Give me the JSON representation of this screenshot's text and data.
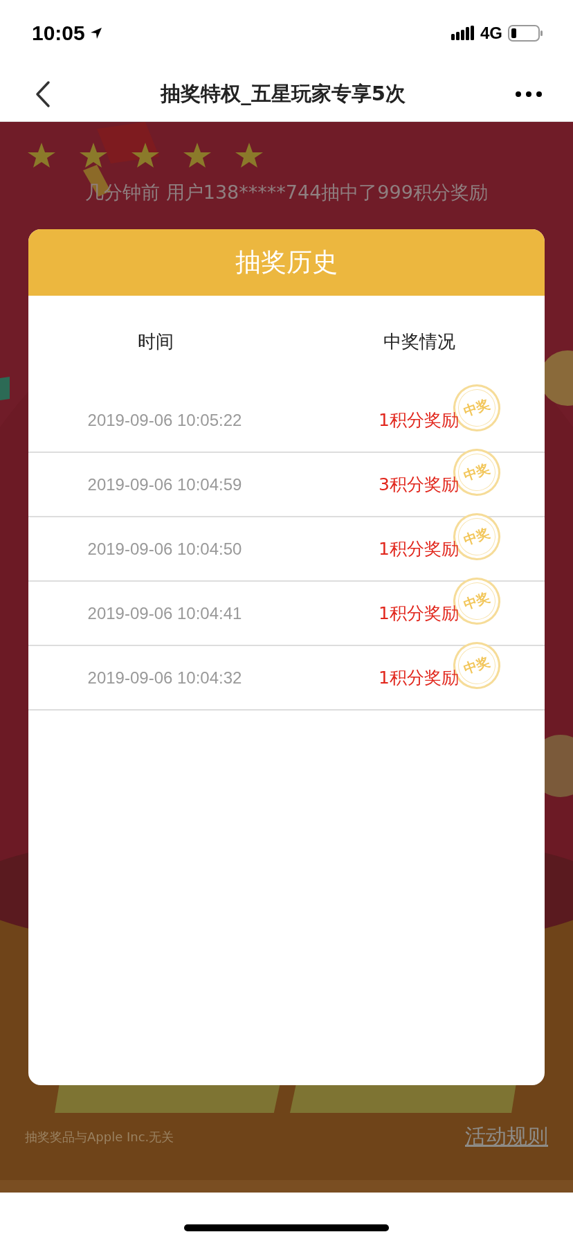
{
  "status_bar": {
    "time": "10:05",
    "network": "4G"
  },
  "nav": {
    "title": "抽奖特权_五星玩家专享5次"
  },
  "ticker": "几分钟前 用户138*****744抽中了999积分奖励",
  "modal": {
    "title": "抽奖历史",
    "columns": [
      "时间",
      "中奖情况"
    ],
    "rows": [
      {
        "time": "2019-09-06 10:05:22",
        "prize": "1积分奖励",
        "stamp": "中奖"
      },
      {
        "time": "2019-09-06 10:04:59",
        "prize": "3积分奖励",
        "stamp": "中奖"
      },
      {
        "time": "2019-09-06 10:04:50",
        "prize": "1积分奖励",
        "stamp": "中奖"
      },
      {
        "time": "2019-09-06 10:04:41",
        "prize": "1积分奖励",
        "stamp": "中奖"
      },
      {
        "time": "2019-09-06 10:04:32",
        "prize": "1积分奖励",
        "stamp": "中奖"
      }
    ]
  },
  "footer": {
    "disclaimer": "抽奖奖品与Apple Inc.无关",
    "rules_link": "活动规则"
  }
}
